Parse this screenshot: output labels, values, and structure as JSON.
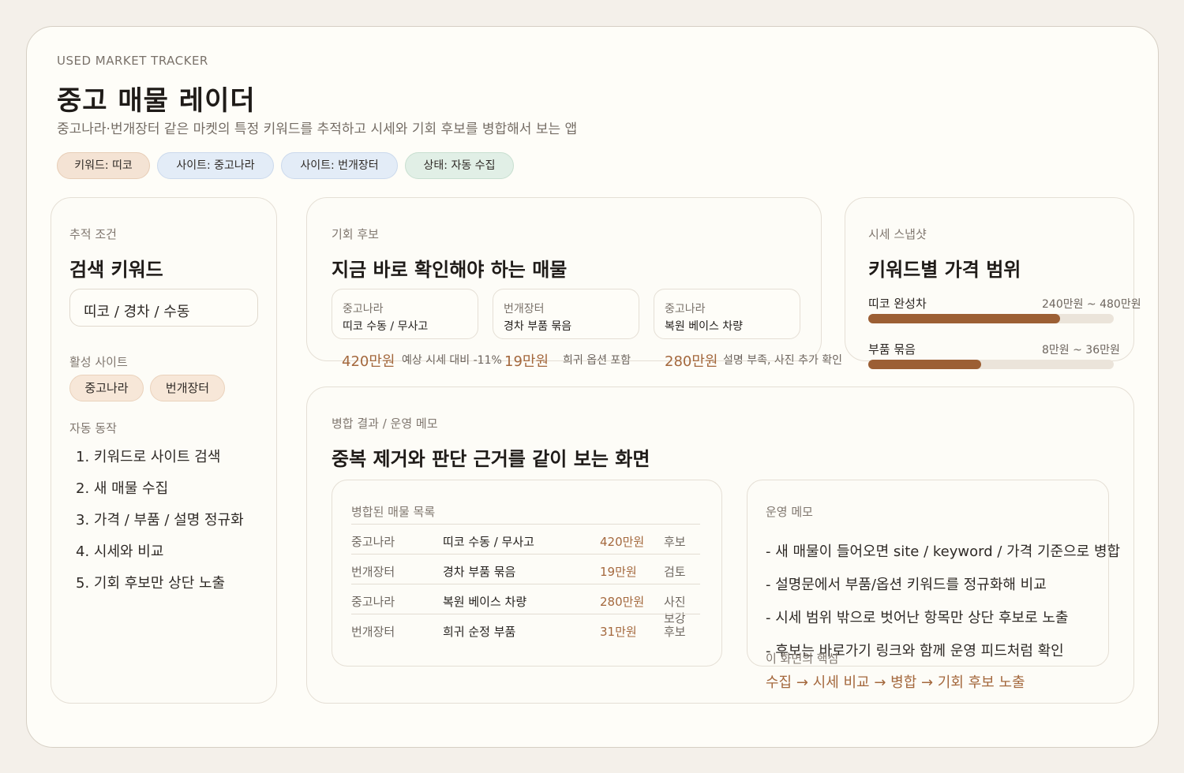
{
  "header": {
    "eyebrow": "USED MARKET TRACKER",
    "title": "중고 매물 레이더",
    "subtitle": "중고나라·번개장터 같은 마켓의 특정 키워드를 추적하고 시세와 기회 후보를 병합해서 보는 앱"
  },
  "status_chips": [
    {
      "label": "키워드: 띠코",
      "tone": "orange"
    },
    {
      "label": "사이트: 중고나라",
      "tone": "blue"
    },
    {
      "label": "사이트: 번개장터",
      "tone": "blue"
    },
    {
      "label": "상태: 자동 수집",
      "tone": "green"
    }
  ],
  "tracking": {
    "label": "추적 조건",
    "title": "검색 키워드",
    "keyword_value": "띠코 / 경차 / 수동",
    "sites_label": "활성 사이트",
    "sites": [
      "중고나라",
      "번개장터"
    ],
    "auto_label": "자동 동작",
    "steps": [
      "1. 키워드로 사이트 검색",
      "2. 새 매물 수집",
      "3. 가격 / 부품 / 설명 정규화",
      "4. 시세와 비교",
      "5. 기회 후보만 상단 노출"
    ]
  },
  "opportunities": {
    "label": "기회 후보",
    "title": "지금 바로 확인해야 하는 매물",
    "items": [
      {
        "site": "중고나라",
        "title": "띠코 수동 / 무사고",
        "price": "420만원",
        "note": "예상 시세 대비 -11%"
      },
      {
        "site": "번개장터",
        "title": "경차 부품 묶음",
        "price": "19만원",
        "note": "희귀 옵션 포함"
      },
      {
        "site": "중고나라",
        "title": "복원 베이스 차량",
        "price": "280만원",
        "note": "설명 부족, 사진 추가 확인"
      }
    ]
  },
  "prices": {
    "label": "시세 스냅샷",
    "title": "키워드별 가격 범위",
    "rows": [
      {
        "name": "띠코 완성차",
        "range": "240만원 ~ 480만원",
        "fill": 0.78
      },
      {
        "name": "부품 묶음",
        "range": "8만원 ~ 36만원",
        "fill": 0.46
      }
    ]
  },
  "merged": {
    "label": "병합 결과 / 운영 메모",
    "title": "중복 제거와 판단 근거를 같이 보는 화면",
    "list_title": "병합된 매물 목록",
    "rows": [
      {
        "site": "중고나라",
        "title": "띠코 수동 / 무사고",
        "price": "420만원",
        "status": "후보"
      },
      {
        "site": "번개장터",
        "title": "경차 부품 묶음",
        "price": "19만원",
        "status": "검토"
      },
      {
        "site": "중고나라",
        "title": "복원 베이스 차량",
        "price": "280만원",
        "status": "사진 보강"
      },
      {
        "site": "번개장터",
        "title": "희귀 순정 부품",
        "price": "31만원",
        "status": "후보"
      }
    ],
    "memo_title": "운영 메모",
    "memos": [
      "- 새 매물이 들어오면 site / keyword / 가격 기준으로 병합",
      "- 설명문에서 부품/옵션 키워드를 정규화해 비교",
      "- 시세 범위 밖으로 벗어난 항목만 상단 후보로 노출",
      "- 후보는 바로가기 링크와 함께 운영 피드처럼 확인"
    ],
    "core_label": "이 화면의 핵심",
    "core_flow": "수집 → 시세 비교 → 병합 → 기회 후보 노출"
  },
  "colors": {
    "accent": "#a4683d",
    "bar": "#9c5f34",
    "chip_orange": "#f4e3d4",
    "chip_blue": "#e3ecf7",
    "chip_green": "#e1efe6"
  }
}
